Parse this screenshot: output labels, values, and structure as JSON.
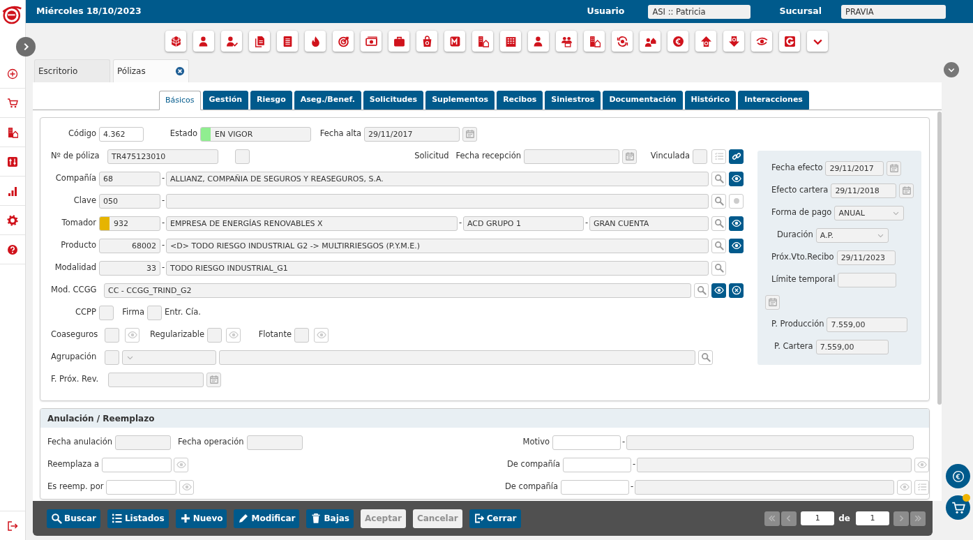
{
  "header": {
    "date": "Miércoles 18/10/2023",
    "user_label": "Usuario",
    "user": "ASI :: Patricia",
    "branch_label": "Sucursal",
    "branch": "PRAVIA"
  },
  "doc_tabs": [
    {
      "label": "Escritorio",
      "selected": false,
      "closable": false
    },
    {
      "label": "Pólizas",
      "selected": true,
      "closable": true
    }
  ],
  "section_tabs": [
    {
      "label": "Básicos",
      "selected": true
    },
    {
      "label": "Gestión",
      "selected": false
    },
    {
      "label": "Riesgo",
      "selected": false
    },
    {
      "label": "Aseg./Benef.",
      "selected": false
    },
    {
      "label": "Solicitudes",
      "selected": false
    },
    {
      "label": "Suplementos",
      "selected": false
    },
    {
      "label": "Recibos",
      "selected": false
    },
    {
      "label": "Siniestros",
      "selected": false
    },
    {
      "label": "Documentación",
      "selected": false
    },
    {
      "label": "Histórico",
      "selected": false
    },
    {
      "label": "Interacciones",
      "selected": false
    }
  ],
  "policy": {
    "rows": [
      {
        "items": [
          {
            "kind": "label",
            "text": "Código"
          },
          {
            "kind": "field",
            "value": "4.362",
            "readonly": false
          },
          {
            "kind": "label",
            "text": "Estado"
          },
          {
            "kind": "field",
            "value": "EN VIGOR",
            "readonly": true,
            "color": "#90ee90"
          },
          {
            "kind": "label",
            "text": "Fecha alta"
          },
          {
            "kind": "field",
            "value": "29/11/2017",
            "readonly": true
          },
          {
            "kind": "calendar",
            "disabled": true
          }
        ]
      },
      {
        "items": [
          {
            "kind": "label",
            "text": "Nº de póliza"
          },
          {
            "kind": "field",
            "value": "TR475123010",
            "readonly": true
          },
          {
            "kind": "check",
            "checked": false
          },
          {
            "kind": "label",
            "text": "Solicitud"
          },
          {
            "kind": "label",
            "text": "Fecha recepción"
          },
          {
            "kind": "field",
            "readonly": true
          },
          {
            "kind": "calendar",
            "disabled": true
          },
          {
            "kind": "label",
            "text": "Vinculada"
          },
          {
            "kind": "check",
            "checked": false
          },
          {
            "kind": "checklist",
            "disabled": true
          },
          {
            "kind": "link",
            "disabled": false
          }
        ]
      },
      {
        "items": [
          {
            "kind": "label",
            "text": "Compañía"
          },
          {
            "kind": "field",
            "value": "68",
            "readonly": true
          },
          {
            "kind": "dash",
            "text": "-"
          },
          {
            "kind": "field",
            "value": "ALLIANZ, COMPAÑIA DE SEGUROS Y REASEGUROS, S.A.",
            "readonly": true
          },
          {
            "kind": "search",
            "disabled": false
          },
          {
            "kind": "view",
            "disabled": false
          }
        ]
      },
      {
        "items": [
          {
            "kind": "label",
            "text": "Clave"
          },
          {
            "kind": "field",
            "value": "050",
            "readonly": true
          },
          {
            "kind": "dash",
            "text": "-"
          },
          {
            "kind": "field",
            "readonly": true
          },
          {
            "kind": "search",
            "disabled": false
          },
          {
            "kind": "dot",
            "disabled": true
          }
        ]
      },
      {
        "items": [
          {
            "kind": "label",
            "text": "Tomador"
          },
          {
            "kind": "field",
            "value": "932",
            "readonly": true,
            "color": "#e6b400"
          },
          {
            "kind": "dash",
            "text": "-"
          },
          {
            "kind": "field",
            "value": "EMPRESA DE ENERGÍAS RENOVABLES X",
            "readonly": true
          },
          {
            "kind": "dash",
            "text": "-"
          },
          {
            "kind": "field",
            "value": "ACD GRUPO 1",
            "readonly": true
          },
          {
            "kind": "dash",
            "text": "-"
          },
          {
            "kind": "field",
            "value": "GRAN CUENTA",
            "readonly": true
          },
          {
            "kind": "search",
            "disabled": false
          },
          {
            "kind": "view",
            "disabled": false
          }
        ]
      },
      {
        "items": [
          {
            "kind": "label",
            "text": "Producto"
          },
          {
            "kind": "field",
            "value": "68002",
            "readonly": true
          },
          {
            "kind": "dash",
            "text": "-"
          },
          {
            "kind": "field",
            "value": "<D> TODO RIESGO INDUSTRIAL G2 -> MULTIRRIESGOS (P.Y.M.E.)",
            "readonly": true
          },
          {
            "kind": "search",
            "disabled": false
          },
          {
            "kind": "view",
            "disabled": false
          }
        ]
      },
      {
        "items": [
          {
            "kind": "label",
            "text": "Modalidad"
          },
          {
            "kind": "field",
            "value": "33",
            "readonly": true
          },
          {
            "kind": "dash",
            "text": "-"
          },
          {
            "kind": "field",
            "value": "TODO RIESGO INDUSTRIAL_G1",
            "readonly": true
          },
          {
            "kind": "search",
            "disabled": false
          }
        ]
      },
      {
        "items": [
          {
            "kind": "label",
            "text": "Mod. CCGG"
          },
          {
            "kind": "field",
            "value": "CC - CCGG_TRIND_G2",
            "readonly": true
          },
          {
            "kind": "search",
            "disabled": false
          },
          {
            "kind": "view",
            "disabled": false
          },
          {
            "kind": "clear",
            "disabled": false
          }
        ]
      },
      {
        "items": [
          {
            "kind": "label",
            "text": "CCPP"
          },
          {
            "kind": "check",
            "checked": false
          },
          {
            "kind": "label",
            "text": "Firma"
          },
          {
            "kind": "check",
            "checked": false
          },
          {
            "kind": "label",
            "text": "Entr. Cía."
          }
        ]
      },
      {
        "items": [
          {
            "kind": "label",
            "text": "Coaseguros"
          },
          {
            "kind": "check",
            "checked": false
          },
          {
            "kind": "view",
            "disabled": true
          },
          {
            "kind": "label",
            "text": "Regularizable"
          },
          {
            "kind": "check",
            "checked": false
          },
          {
            "kind": "view",
            "disabled": true
          },
          {
            "kind": "label",
            "text": "Flotante"
          },
          {
            "kind": "check",
            "checked": false
          },
          {
            "kind": "view",
            "disabled": true
          }
        ]
      },
      {
        "items": [
          {
            "kind": "label",
            "text": "Agrupación"
          },
          {
            "kind": "check",
            "checked": false
          },
          {
            "kind": "select",
            "readonly": true
          },
          {
            "kind": "field",
            "readonly": true
          },
          {
            "kind": "search",
            "disabled": false
          }
        ]
      },
      {
        "items": [
          {
            "kind": "label",
            "text": "F. Próx. Rev."
          },
          {
            "kind": "field",
            "readonly": true
          },
          {
            "kind": "calendar",
            "disabled": true
          }
        ]
      }
    ],
    "side_rows": [
      {
        "items": [
          {
            "kind": "label",
            "text": "Fecha efecto"
          },
          {
            "kind": "field",
            "value": "29/11/2017",
            "readonly": true
          },
          {
            "kind": "calendar",
            "disabled": true
          }
        ]
      },
      {
        "items": [
          {
            "kind": "label",
            "text": "Efecto cartera"
          },
          {
            "kind": "field",
            "value": "29/11/2018",
            "readonly": true
          },
          {
            "kind": "calendar",
            "disabled": true
          }
        ]
      },
      {
        "items": [
          {
            "kind": "label",
            "text": "Forma de pago"
          },
          {
            "kind": "select",
            "value": "ANUAL",
            "readonly": true
          }
        ]
      },
      {
        "items": [
          {
            "kind": "label",
            "text": "Duración"
          },
          {
            "kind": "select",
            "value": "A.P.",
            "readonly": true
          }
        ]
      },
      {
        "items": [
          {
            "kind": "label",
            "text": "Próx.Vto.Recibo"
          },
          {
            "kind": "field",
            "value": "29/11/2023",
            "readonly": true
          }
        ]
      },
      {
        "items": [
          {
            "kind": "label",
            "text": "Límite temporal"
          },
          {
            "kind": "field",
            "readonly": true
          }
        ]
      },
      {
        "items": [
          {
            "kind": "calendar",
            "disabled": true
          }
        ]
      },
      {
        "items": [
          {
            "kind": "label",
            "text": "P. Producción"
          },
          {
            "kind": "field",
            "value": "7.559,00",
            "readonly": true
          }
        ]
      },
      {
        "items": [
          {
            "kind": "label",
            "text": "P. Cartera"
          },
          {
            "kind": "field",
            "value": "7.559,00",
            "readonly": true
          }
        ]
      }
    ]
  },
  "cancellation": {
    "title": "Anulación / Reemplazo",
    "rows": [
      {
        "left": [
          {
            "kind": "label",
            "text": "Fecha anulación"
          },
          {
            "kind": "field",
            "readonly": true
          },
          {
            "kind": "label",
            "text": "Fecha operación"
          },
          {
            "kind": "field",
            "readonly": true
          }
        ],
        "right": [
          {
            "kind": "label",
            "text": "Motivo"
          },
          {
            "kind": "field",
            "readonly": false
          },
          {
            "kind": "dash",
            "text": "-"
          },
          {
            "kind": "field",
            "readonly": true
          }
        ]
      },
      {
        "left": [
          {
            "kind": "label",
            "text": "Reemplaza a"
          },
          {
            "kind": "field",
            "readonly": false
          },
          {
            "kind": "view",
            "disabled": true
          }
        ],
        "right": [
          {
            "kind": "label",
            "text": "De compañía"
          },
          {
            "kind": "field",
            "readonly": false
          },
          {
            "kind": "dash",
            "text": "-"
          },
          {
            "kind": "field",
            "readonly": true
          },
          {
            "kind": "view",
            "disabled": true
          }
        ]
      },
      {
        "left": [
          {
            "kind": "label",
            "text": "Es reemp. por"
          },
          {
            "kind": "field",
            "readonly": false
          },
          {
            "kind": "view",
            "disabled": true
          }
        ],
        "right": [
          {
            "kind": "label",
            "text": "De compañía"
          },
          {
            "kind": "field",
            "readonly": false
          },
          {
            "kind": "dash",
            "text": "-"
          },
          {
            "kind": "field",
            "readonly": true
          },
          {
            "kind": "view",
            "disabled": true
          },
          {
            "kind": "checklist",
            "disabled": true
          }
        ]
      }
    ]
  },
  "actions": [
    {
      "label": "Buscar",
      "kind": "search",
      "disabled": false
    },
    {
      "label": "Listados",
      "kind": "list",
      "disabled": false
    },
    {
      "label": "Nuevo",
      "kind": "add",
      "disabled": false
    },
    {
      "label": "Modificar",
      "kind": "edit",
      "disabled": false
    },
    {
      "label": "Bajas",
      "kind": "delete",
      "disabled": false
    },
    {
      "label": "Aceptar",
      "kind": "accept",
      "disabled": true
    },
    {
      "label": "Cancelar",
      "kind": "cancel",
      "disabled": true
    },
    {
      "label": "Cerrar",
      "kind": "exit",
      "disabled": false
    }
  ],
  "pager": {
    "page": "1",
    "of_label": "de",
    "total": "1",
    "nav": [
      {
        "kind": "first",
        "disabled": true
      },
      {
        "kind": "prev",
        "disabled": true
      },
      {
        "kind": "next",
        "disabled": true
      },
      {
        "kind": "last",
        "disabled": true
      }
    ]
  }
}
